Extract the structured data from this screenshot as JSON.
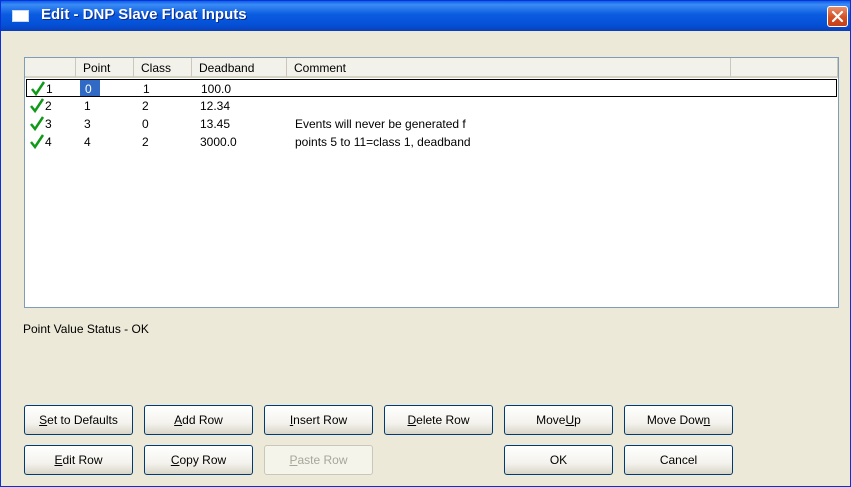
{
  "window": {
    "title": "Edit - DNP Slave Float Inputs"
  },
  "table": {
    "columns": [
      "",
      "Point",
      "Class",
      "Deadband",
      "Comment"
    ],
    "rows": [
      {
        "num": "1",
        "point": "0",
        "class": "1",
        "deadband": "100.0",
        "comment": ""
      },
      {
        "num": "2",
        "point": "1",
        "class": "2",
        "deadband": "12.34",
        "comment": ""
      },
      {
        "num": "3",
        "point": "3",
        "class": "0",
        "deadband": "13.45",
        "comment": "Events will never be generated f"
      },
      {
        "num": "4",
        "point": "4",
        "class": "2",
        "deadband": "3000.0",
        "comment": "points 5 to 11=class 1, deadband"
      }
    ]
  },
  "status": {
    "text": "Point Value Status - OK"
  },
  "buttons": {
    "set_defaults": {
      "pre": "",
      "key": "S",
      "post": "et to Defaults"
    },
    "add_row": {
      "pre": "",
      "key": "A",
      "post": "dd Row"
    },
    "insert_row": {
      "pre": "",
      "key": "I",
      "post": "nsert Row"
    },
    "delete_row": {
      "pre": "",
      "key": "D",
      "post": "elete Row"
    },
    "move_up": {
      "pre": "Move ",
      "key": "U",
      "post": "p"
    },
    "move_down": {
      "pre": "Move Dow",
      "key": "n",
      "post": ""
    },
    "edit_row": {
      "pre": "",
      "key": "E",
      "post": "dit Row"
    },
    "copy_row": {
      "pre": "",
      "key": "C",
      "post": "opy Row"
    },
    "paste_row": {
      "pre": "",
      "key": "P",
      "post": "aste Row"
    },
    "ok": {
      "label": "OK"
    },
    "cancel": {
      "label": "Cancel"
    }
  },
  "colors": {
    "titlebar": "#0a5fe8",
    "selection": "#316ac5",
    "check": "#0f9a17",
    "face": "#ece9d8"
  },
  "icons": {
    "row_status": "checkmark-icon",
    "close": "close-icon",
    "window": "window-icon"
  }
}
